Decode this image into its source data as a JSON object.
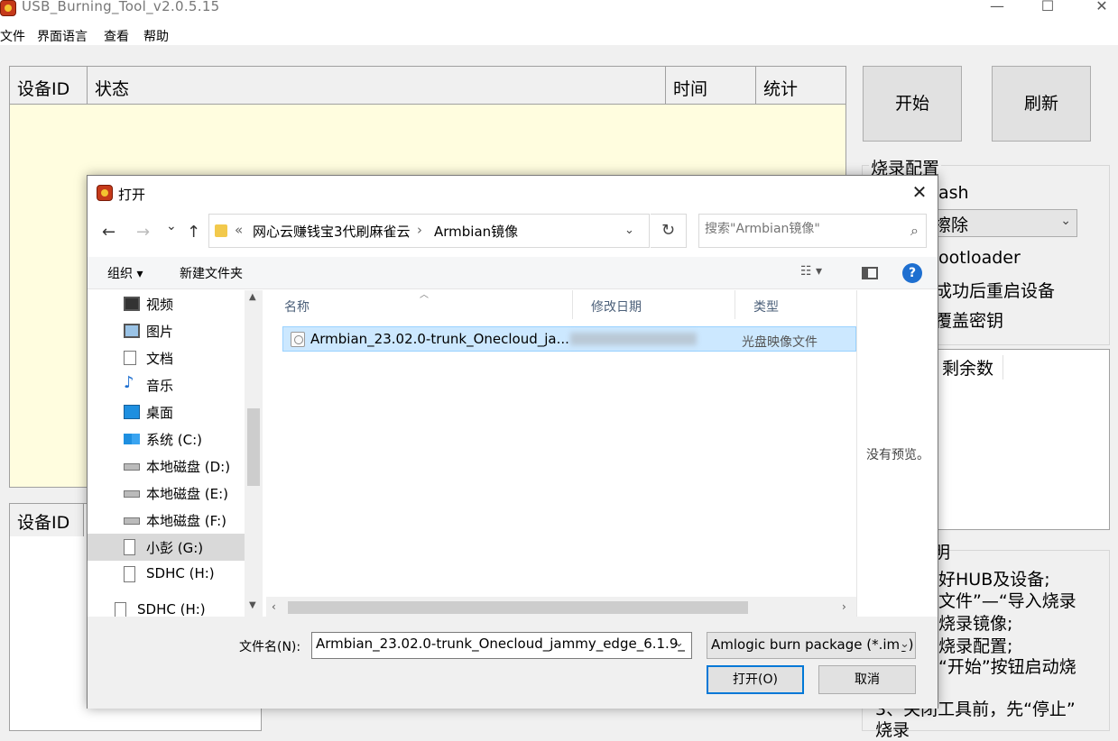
{
  "app": {
    "title": "USB_Burning_Tool_v2.0.5.15",
    "menu": [
      "文件",
      "界面语言",
      "查看",
      "帮助"
    ],
    "window_controls": {
      "minimize": "—",
      "maximize": "☐",
      "close": "✕"
    }
  },
  "grid_top": {
    "headers": [
      "设备ID",
      "状态",
      "时间",
      "统计"
    ]
  },
  "grid_bottom": {
    "header": "设备ID"
  },
  "buttons": {
    "start": "开始",
    "refresh": "刷新"
  },
  "config": {
    "title": "烧录配置",
    "erase_flash": "ash",
    "erase_mode": "擦除",
    "bootloader": "ootloader",
    "reboot": "成功后重启设备",
    "overwrite_key": "覆盖密钥"
  },
  "stats": {
    "remaining": "剩余数"
  },
  "help": {
    "title_fragment": "明",
    "lines": [
      "好HUB及设备;",
      "文件”—“导入烧录",
      "烧录镜像;",
      "烧录配置;",
      "“开始”按钮启动烧",
      "3、关闭工具前，先“停止”",
      "烧录"
    ]
  },
  "dialog": {
    "title": "打开",
    "close": "✕",
    "nav": {
      "back": "←",
      "forward": "→",
      "recent": "⌄",
      "up": "↑"
    },
    "breadcrumb": {
      "prefix": "«",
      "parts": [
        "网心云赚钱宝3代刷麻雀云",
        "Armbian镜像"
      ],
      "separator": "›"
    },
    "search_placeholder": "搜索\"Armbian镜像\"",
    "commands": {
      "organize": "组织 ▾",
      "new_folder": "新建文件夹"
    },
    "sidebar": [
      {
        "label": "视频",
        "icon": "video-icon"
      },
      {
        "label": "图片",
        "icon": "picture-icon"
      },
      {
        "label": "文档",
        "icon": "document-icon"
      },
      {
        "label": "音乐",
        "icon": "music-icon"
      },
      {
        "label": "桌面",
        "icon": "desktop-icon"
      },
      {
        "label": "系统 (C:)",
        "icon": "system-drive-icon"
      },
      {
        "label": "本地磁盘 (D:)",
        "icon": "drive-icon"
      },
      {
        "label": "本地磁盘 (E:)",
        "icon": "drive-icon"
      },
      {
        "label": "本地磁盘 (F:)",
        "icon": "drive-icon"
      },
      {
        "label": "小彭 (G:)",
        "icon": "removable-drive-icon",
        "selected": true
      },
      {
        "label": "SDHC (H:)",
        "icon": "removable-drive-icon"
      },
      {
        "label": "SDHC (H:)",
        "icon": "removable-drive-icon"
      }
    ],
    "columns": [
      "名称",
      "修改日期",
      "类型"
    ],
    "files": [
      {
        "name": "Armbian_23.02.0-trunk_Onecloud_ja...",
        "type": "光盘映像文件"
      }
    ],
    "no_preview": "没有预览。",
    "filename_label": "文件名(N):",
    "filename_value": "Armbian_23.02.0-trunk_Onecloud_jammy_edge_6.1.9_",
    "filetype": "Amlogic burn package (*.img)",
    "open": "打开(O)",
    "cancel": "取消"
  }
}
